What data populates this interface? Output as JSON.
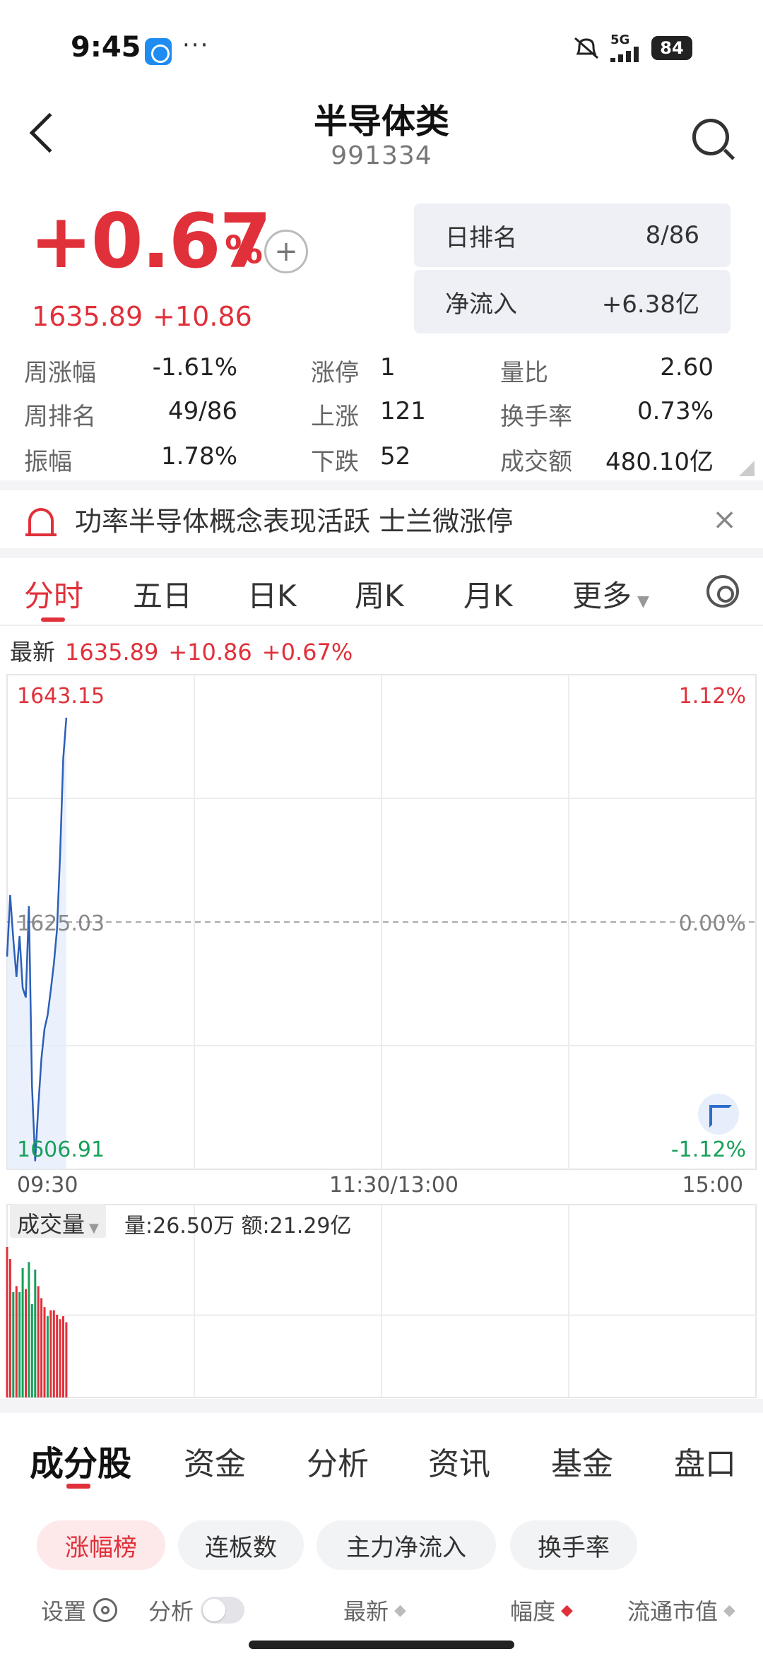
{
  "status": {
    "time": "9:45",
    "dots": "···",
    "network": "5G",
    "battery": "84"
  },
  "header": {
    "title": "半导体类",
    "code": "991334"
  },
  "quote": {
    "change_pct": "+0.67",
    "pct_sign": "%",
    "price": "1635.89",
    "change": "+10.86",
    "add_label": "+"
  },
  "rank": {
    "daily_rank_label": "日排名",
    "daily_rank_value": "8/86",
    "net_inflow_label": "净流入",
    "net_inflow_value": "+6.38亿"
  },
  "stats": {
    "week_change_label": "周涨幅",
    "week_change_value": "-1.61%",
    "week_rank_label": "周排名",
    "week_rank_value": "49/86",
    "amplitude_label": "振幅",
    "amplitude_value": "1.78%",
    "limit_up_label": "涨停",
    "limit_up_value": "1",
    "rise_label": "上涨",
    "rise_value": "121",
    "fall_label": "下跌",
    "fall_value": "52",
    "volume_ratio_label": "量比",
    "volume_ratio_value": "2.60",
    "turnover_label": "换手率",
    "turnover_value": "0.73%",
    "amount_label": "成交额",
    "amount_value": "480.10亿"
  },
  "news": {
    "text": "功率半导体概念表现活跃 士兰微涨停",
    "close": "×"
  },
  "chart_tabs": [
    "分时",
    "五日",
    "日K",
    "周K",
    "月K",
    "更多"
  ],
  "latest": {
    "label": "最新",
    "price": "1635.89",
    "change": "+10.86",
    "pct": "+0.67%"
  },
  "chart_data": {
    "type": "line",
    "y_max_label": "1643.15",
    "y_mid_label": "1625.03",
    "y_min_label": "1606.91",
    "pct_max_label": "1.12%",
    "pct_mid_label": "0.00%",
    "pct_min_label": "-1.12%",
    "ylim": [
      1606.91,
      1643.15
    ],
    "baseline": 1625.03,
    "x_labels": [
      "09:30",
      "11:30/13:00",
      "15:00"
    ],
    "total_minutes": 240,
    "minutes": [
      0,
      1,
      2,
      3,
      4,
      5,
      6,
      7,
      8,
      9,
      10,
      11,
      12,
      13,
      14,
      15,
      16,
      17,
      18,
      19
    ],
    "prices": [
      1622.5,
      1627.0,
      1623.8,
      1621.0,
      1624.0,
      1620.2,
      1619.5,
      1626.2,
      1613.0,
      1607.5,
      1611.5,
      1615.0,
      1617.2,
      1618.2,
      1620.0,
      1622.0,
      1624.5,
      1630.0,
      1637.0,
      1640.0
    ],
    "volume": {
      "label": "成交量",
      "info": "量:26.50万 额:21.29亿",
      "values": [
        100,
        92,
        70,
        74,
        70,
        86,
        72,
        90,
        62,
        85,
        74,
        66,
        60,
        54,
        58,
        58,
        55,
        52,
        54,
        50
      ],
      "colors": [
        "red",
        "red",
        "green",
        "red",
        "green",
        "green",
        "red",
        "green",
        "green",
        "green",
        "red",
        "red",
        "red",
        "green",
        "red",
        "red",
        "red",
        "red",
        "red",
        "red"
      ]
    }
  },
  "bottom_tabs": [
    "成分股",
    "资金",
    "分析",
    "资讯",
    "基金",
    "盘口"
  ],
  "chips": [
    "涨幅榜",
    "连板数",
    "主力净流入",
    "换手率"
  ],
  "columns": {
    "settings": "设置",
    "analysis": "分析",
    "latest": "最新",
    "range": "幅度",
    "market_cap": "流通市值"
  },
  "colors": {
    "red": "#e0303a",
    "green": "#17a05a",
    "line": "#2c5fb8"
  }
}
